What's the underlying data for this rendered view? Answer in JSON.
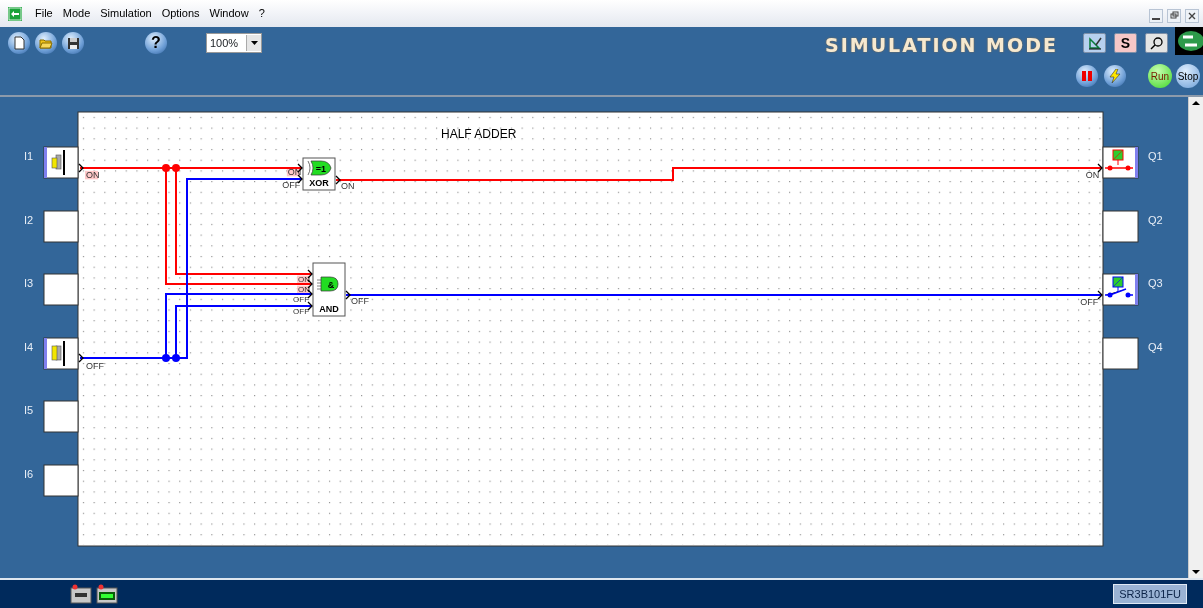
{
  "menu": [
    {
      "label": "File"
    },
    {
      "label": "Mode"
    },
    {
      "label": "Simulation"
    },
    {
      "label": "Options"
    },
    {
      "label": "Window"
    },
    {
      "label": "?"
    }
  ],
  "toolbar": {
    "help": "?",
    "zoom": "100%",
    "mode_title": "SIMULATION MODE",
    "s_button": "S",
    "run": "Run",
    "stop": "Stop"
  },
  "diagram": {
    "title": "HALF ADDER",
    "inputs": [
      {
        "label": "I1",
        "kind": "pushbutton",
        "on": true,
        "state": "ON"
      },
      {
        "label": "I2",
        "kind": "empty"
      },
      {
        "label": "I3",
        "kind": "empty"
      },
      {
        "label": "I4",
        "kind": "pushbutton",
        "on": false,
        "state": "OFF"
      },
      {
        "label": "I5",
        "kind": "empty"
      },
      {
        "label": "I6",
        "kind": "empty"
      }
    ],
    "blocks": [
      {
        "kind": "xor",
        "symbol": "=1",
        "label": "XOR",
        "pins": [
          {
            "state": "ON",
            "on": true
          },
          {
            "state": "OFF",
            "on": false
          }
        ],
        "output": {
          "state": "ON",
          "on": true
        }
      },
      {
        "kind": "and",
        "symbol": "&",
        "label": "AND",
        "pins": [
          {
            "state": "ON",
            "on": true
          },
          {
            "state": "ON",
            "on": true
          },
          {
            "state": "OFF",
            "on": false
          },
          {
            "state": "OFF",
            "on": false
          }
        ],
        "output": {
          "state": "OFF",
          "on": false
        }
      }
    ],
    "outputs": [
      {
        "label": "Q1",
        "kind": "coil",
        "on": true,
        "state": "ON"
      },
      {
        "label": "Q2",
        "kind": "empty"
      },
      {
        "label": "Q3",
        "kind": "coil",
        "on": false,
        "state": "OFF"
      },
      {
        "label": "Q4",
        "kind": "empty"
      }
    ]
  },
  "status_bar": {
    "model": "SR3B101FU"
  }
}
